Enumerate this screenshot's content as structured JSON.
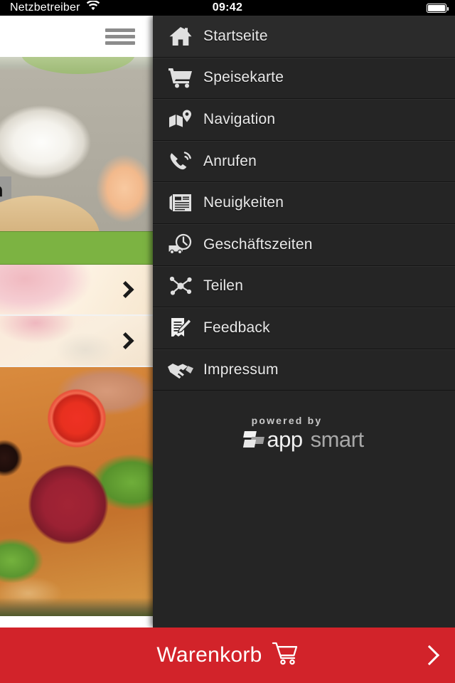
{
  "status_bar": {
    "carrier": "Netzbetreiber",
    "wifi_icon": "wifi-icon",
    "time": "09:42",
    "battery_icon": "battery-full-icon"
  },
  "background_app": {
    "menu_toggle_icon": "hamburger-icon",
    "hero_caption": "za",
    "rows": [
      {
        "chevron_icon": "chevron-right-icon"
      },
      {
        "chevron_icon": "chevron-right-icon"
      }
    ]
  },
  "drawer": {
    "items": [
      {
        "label": "Startseite",
        "icon": "home-icon",
        "active": true
      },
      {
        "label": "Speisekarte",
        "icon": "shopping-cart-icon",
        "active": false
      },
      {
        "label": "Navigation",
        "icon": "map-pin-icon",
        "active": false
      },
      {
        "label": "Anrufen",
        "icon": "phone-icon",
        "active": false
      },
      {
        "label": "Neuigkeiten",
        "icon": "newspaper-icon",
        "active": false
      },
      {
        "label": "Geschäftszeiten",
        "icon": "clock-truck-icon",
        "active": false
      },
      {
        "label": "Teilen",
        "icon": "share-icon",
        "active": false
      },
      {
        "label": "Feedback",
        "icon": "edit-document-icon",
        "active": false
      },
      {
        "label": "Impressum",
        "icon": "handshake-icon",
        "active": false
      }
    ],
    "footer": {
      "powered_by": "powered by",
      "brand_first": "app",
      "brand_second": "smart",
      "logo_icon": "appsmart-logo-icon"
    }
  },
  "cart_bar": {
    "label": "Warenkorb",
    "cart_icon": "shopping-cart-icon",
    "chevron_icon": "chevron-right-icon"
  },
  "colors": {
    "drawer_bg": "#252525",
    "drawer_active": "#2b2b2b",
    "cart_red": "#d2232a",
    "band_green": "#7cb342",
    "text_light": "#e9e9e9"
  }
}
